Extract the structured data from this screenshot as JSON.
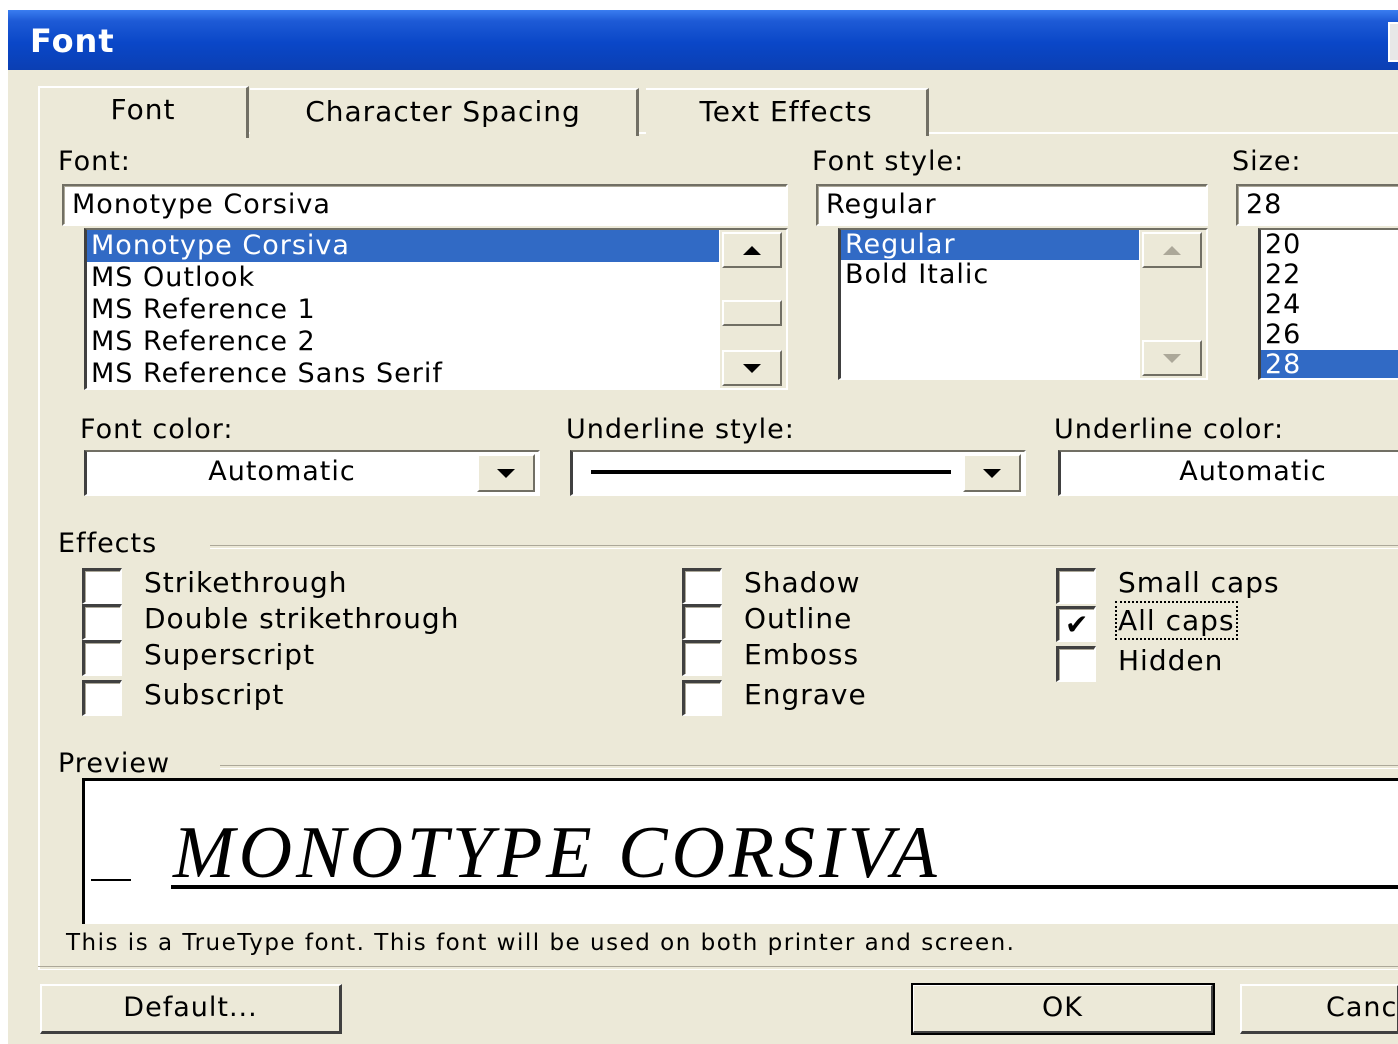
{
  "window": {
    "title": "Font"
  },
  "tabs": [
    {
      "label": "Font",
      "active": true
    },
    {
      "label": "Character Spacing",
      "active": false
    },
    {
      "label": "Text Effects",
      "active": false
    }
  ],
  "font": {
    "label": "Font:",
    "value": "Monotype Corsiva",
    "items": [
      "Monotype Corsiva",
      "MS Outlook",
      "MS Reference 1",
      "MS Reference 2",
      "MS Reference Sans Serif"
    ],
    "selected": "Monotype Corsiva"
  },
  "font_style": {
    "label": "Font style:",
    "value": "Regular",
    "items": [
      "Regular",
      "Bold Italic"
    ],
    "selected": "Regular"
  },
  "size": {
    "label": "Size:",
    "value": "28",
    "items": [
      "20",
      "22",
      "24",
      "26",
      "28"
    ],
    "selected": "28"
  },
  "font_color": {
    "label": "Font color:",
    "value": "Automatic"
  },
  "underline_style": {
    "label": "Underline style:",
    "value": "single-line"
  },
  "underline_color": {
    "label": "Underline color:",
    "value": "Automatic"
  },
  "effects": {
    "label": "Effects",
    "col1": [
      {
        "label": "Strikethrough",
        "checked": false
      },
      {
        "label": "Double strikethrough",
        "checked": false
      },
      {
        "label": "Superscript",
        "checked": false
      },
      {
        "label": "Subscript",
        "checked": false
      }
    ],
    "col2": [
      {
        "label": "Shadow",
        "checked": false
      },
      {
        "label": "Outline",
        "checked": false
      },
      {
        "label": "Emboss",
        "checked": false
      },
      {
        "label": "Engrave",
        "checked": false
      }
    ],
    "col3": [
      {
        "label": "Small caps",
        "checked": false
      },
      {
        "label": "All caps",
        "checked": true
      },
      {
        "label": "Hidden",
        "checked": false
      }
    ]
  },
  "preview": {
    "label": "Preview",
    "text": "MONOTYPE CORSIVA",
    "info": "This is a TrueType font. This font will be used on both printer and screen."
  },
  "buttons": {
    "default": "Default...",
    "ok": "OK",
    "cancel": "Cancel"
  },
  "colors": {
    "titlebar": "#0a47c8",
    "selection": "#316ac5",
    "face": "#ece9d8"
  }
}
